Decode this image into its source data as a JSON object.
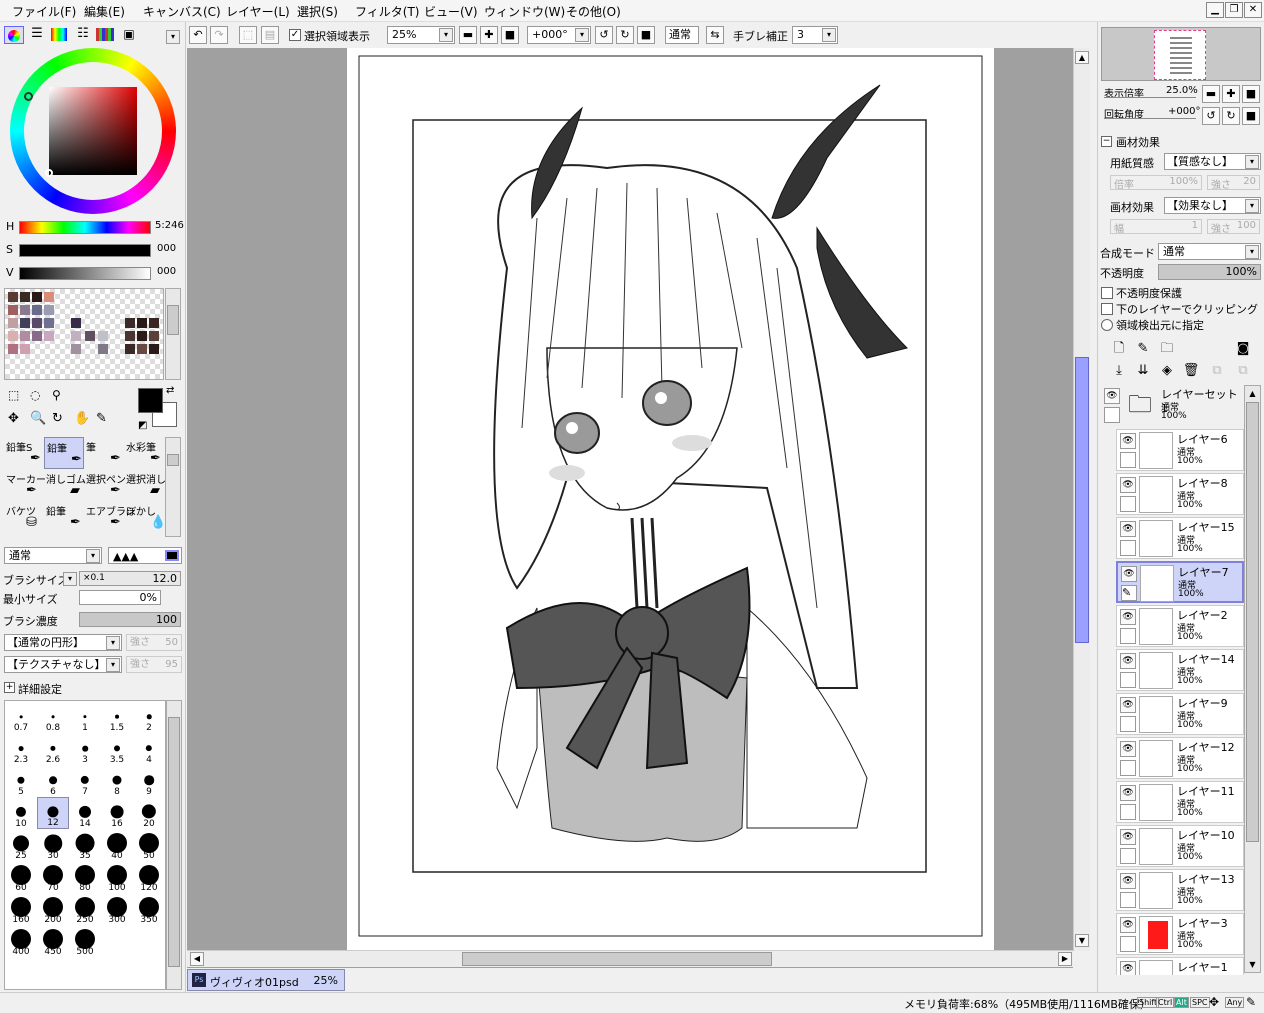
{
  "menu": [
    "ファイル(F)",
    "編集(E)",
    "キャンバス(C)",
    "レイヤー(L)",
    "選択(S)",
    "フィルタ(T)",
    "ビュー(V)",
    "ウィンドウ(W)",
    "その他(O)"
  ],
  "toolbar": {
    "select_display": "選択領域表示",
    "zoom": "25%",
    "rotation": "+000°",
    "blend": "通常",
    "stabilizer_label": "手ブレ補正",
    "stabilizer_value": "3"
  },
  "color": {
    "h_label": "H",
    "h_value": "5:246",
    "s_label": "S",
    "s_value": "000",
    "v_label": "V",
    "v_value": "000",
    "accent": "#b00000"
  },
  "tools": [
    {
      "name": "鉛筆S"
    },
    {
      "name": "鉛筆"
    },
    {
      "name": "筆"
    },
    {
      "name": "水彩筆"
    },
    {
      "name": "マーカー"
    },
    {
      "name": "消しゴム"
    },
    {
      "name": "選択ペン"
    },
    {
      "name": "選択消し"
    },
    {
      "name": "バケツ"
    },
    {
      "name": "鉛筆"
    },
    {
      "name": "エアブラシ"
    },
    {
      "name": "ぼかし"
    }
  ],
  "brush": {
    "mode": "通常",
    "size_label": "ブラシサイズ",
    "size_mult": "×0.1",
    "size_value": "12.0",
    "min_label": "最小サイズ",
    "min_value": "0%",
    "density_label": "ブラシ濃度",
    "density_value": "100",
    "shape": "【通常の円形】",
    "shape_strength_label": "強さ",
    "shape_strength": "50",
    "texture": "【テクスチャなし】",
    "texture_strength_label": "強さ",
    "texture_strength": "95",
    "detail": "詳細設定",
    "sizes": [
      "0.7",
      "0.8",
      "1",
      "1.5",
      "2",
      "2.3",
      "2.6",
      "3",
      "3.5",
      "4",
      "5",
      "6",
      "7",
      "8",
      "9",
      "10",
      "12",
      "14",
      "16",
      "20",
      "25",
      "30",
      "35",
      "40",
      "50",
      "60",
      "70",
      "80",
      "100",
      "120",
      "160",
      "200",
      "250",
      "300",
      "350",
      "400",
      "450",
      "500"
    ]
  },
  "document_tab": {
    "name": "ヴィヴィオ01psd",
    "zoom": "25%"
  },
  "navigator": {
    "zoom_label": "表示倍率",
    "zoom_value": "25.0%",
    "rotation_label": "回転角度",
    "rotation_value": "+000°"
  },
  "effects": {
    "title": "画材効果",
    "paper_label": "用紙質感",
    "paper_value": "【質感なし】",
    "paper_scale_label": "倍率",
    "paper_scale": "100%",
    "paper_strength_label": "強さ",
    "paper_strength": "20",
    "effect_label": "画材効果",
    "effect_value": "【効果なし】",
    "effect_width_label": "幅",
    "effect_width": "1",
    "effect_strength_label": "強さ",
    "effect_strength": "100"
  },
  "layer_props": {
    "blend_label": "合成モード",
    "blend_value": "通常",
    "opacity_label": "不透明度",
    "opacity_value": "100%",
    "preserve_opacity": "不透明度保護",
    "clipping": "下のレイヤーでクリッピング",
    "selection_source": "領域検出元に指定"
  },
  "layers": [
    {
      "name": "レイヤーセット1",
      "mode": "通常",
      "opacity": "100%",
      "type": "folder"
    },
    {
      "name": "レイヤー6",
      "mode": "通常",
      "opacity": "100%"
    },
    {
      "name": "レイヤー8",
      "mode": "通常",
      "opacity": "100%"
    },
    {
      "name": "レイヤー15",
      "mode": "通常",
      "opacity": "100%"
    },
    {
      "name": "レイヤー7",
      "mode": "通常",
      "opacity": "100%",
      "selected": true
    },
    {
      "name": "レイヤー2",
      "mode": "通常",
      "opacity": "100%"
    },
    {
      "name": "レイヤー14",
      "mode": "通常",
      "opacity": "100%"
    },
    {
      "name": "レイヤー9",
      "mode": "通常",
      "opacity": "100%"
    },
    {
      "name": "レイヤー12",
      "mode": "通常",
      "opacity": "100%"
    },
    {
      "name": "レイヤー11",
      "mode": "通常",
      "opacity": "100%"
    },
    {
      "name": "レイヤー10",
      "mode": "通常",
      "opacity": "100%"
    },
    {
      "name": "レイヤー13",
      "mode": "通常",
      "opacity": "100%"
    },
    {
      "name": "レイヤー3",
      "mode": "通常",
      "opacity": "100%",
      "thumb_color": "#ff1a1a"
    },
    {
      "name": "レイヤー1",
      "mode": "",
      "opacity": ""
    }
  ],
  "status": {
    "memory": "メモリ負荷率:68%（495MB使用/1116MB確保）",
    "keys": [
      "Shift",
      "Ctrl",
      "Alt",
      "SPC",
      "Any"
    ]
  }
}
